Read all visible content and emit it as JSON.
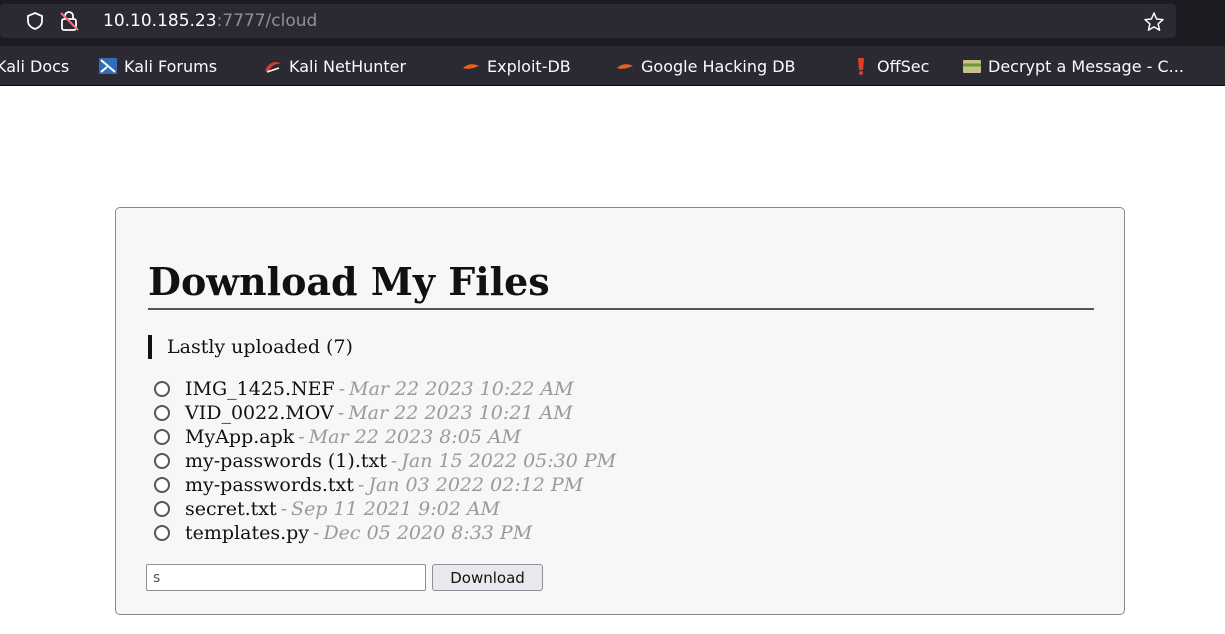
{
  "browser": {
    "url_host": "10.10.185.23",
    "url_path": ":7777/cloud",
    "bookmarks": [
      {
        "label": "Kali Docs",
        "icon": "kali-docs-icon"
      },
      {
        "label": "Kali Forums",
        "icon": "kali-forums-icon"
      },
      {
        "label": "Kali NetHunter",
        "icon": "kali-nethunter-icon"
      },
      {
        "label": "Exploit-DB",
        "icon": "exploit-db-icon"
      },
      {
        "label": "Google Hacking DB",
        "icon": "google-hacking-db-icon"
      },
      {
        "label": "OffSec",
        "icon": "offsec-icon"
      },
      {
        "label": "Decrypt a Message - C...",
        "icon": "decrypt-message-icon"
      }
    ]
  },
  "page": {
    "title": "Download My Files",
    "subheading": "Lastly uploaded (7)",
    "files": [
      {
        "name": "IMG_1425.NEF",
        "date": "Mar 22 2023 10:22 AM"
      },
      {
        "name": "VID_0022.MOV",
        "date": "Mar 22 2023 10:21 AM"
      },
      {
        "name": "MyApp.apk",
        "date": "Mar 22 2023 8:05 AM"
      },
      {
        "name": "my-passwords (1).txt",
        "date": "Jan 15 2022 05:30 PM"
      },
      {
        "name": "my-passwords.txt",
        "date": "Jan 03 2022 02:12 PM"
      },
      {
        "name": "secret.txt",
        "date": "Sep 11 2021 9:02 AM"
      },
      {
        "name": "templates.py",
        "date": "Dec 05 2020 8:33 PM"
      }
    ],
    "separator": "-",
    "input_value": "s",
    "download_label": "Download"
  },
  "colors": {
    "chrome_dark": "#1c1b22",
    "urlbar": "#2b2a33",
    "card_bg": "#f7f7f7",
    "date_gray": "#9a9a9a"
  }
}
